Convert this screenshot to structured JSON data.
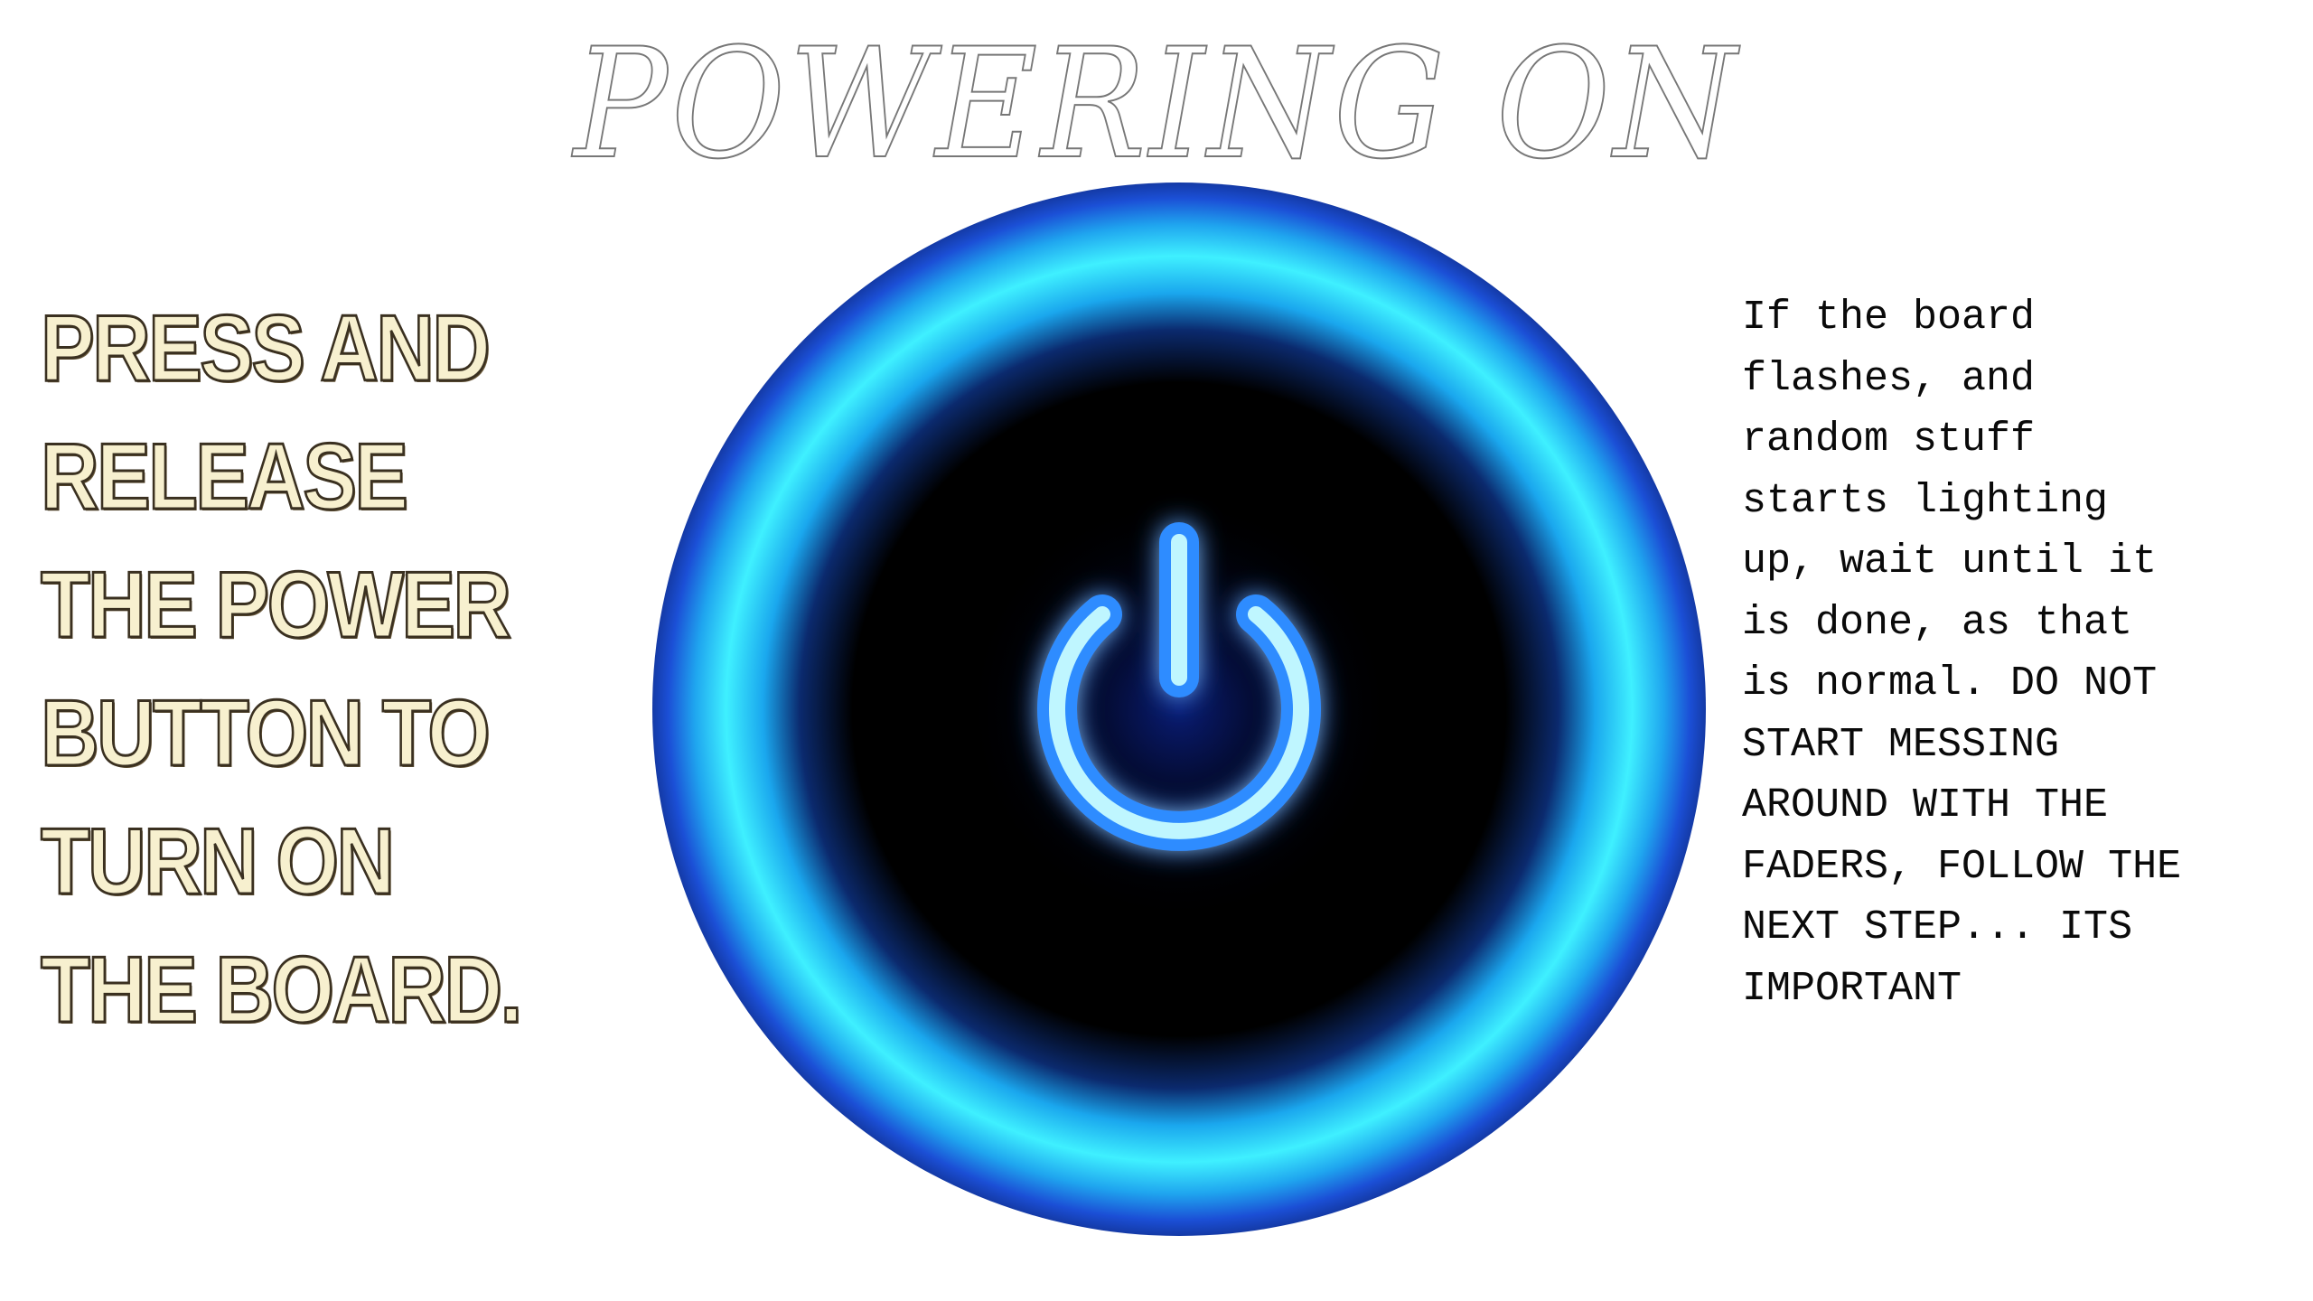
{
  "title": "POWERING ON",
  "instruction_left": "PRESS AND\nRELEASE\nTHE POWER\nBUTTON TO\nTURN ON\nTHE BOARD.",
  "instruction_right": "If the board\nflashes, and\nrandom stuff\nstarts lighting\nup, wait until it\nis done, as that\nis normal. DO NOT\nSTART MESSING\nAROUND WITH THE\nFADERS, FOLLOW THE\nNEXT STEP... ITS\nIMPORTANT",
  "icons": {
    "power": "power-icon"
  },
  "colors": {
    "ring_outer": "#1b4fd6",
    "ring_glow": "#28d6f0",
    "center": "#000000",
    "symbol": "#bff6ff",
    "left_text_fill": "#f7f0cf"
  }
}
